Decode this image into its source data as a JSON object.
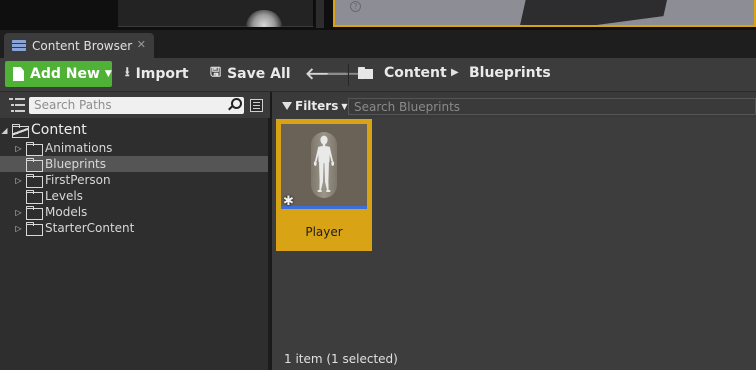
{
  "tab": {
    "title": "Content Browser",
    "close_glyph": "✕"
  },
  "toolbar": {
    "add_new": "Add New",
    "import": "Import",
    "save_all": "Save All",
    "back_glyph": "🡐",
    "forward_glyph": "🡒"
  },
  "breadcrumb": {
    "items": [
      "Content",
      "Blueprints"
    ],
    "separator": "▶"
  },
  "sources": {
    "search_placeholder": "Search Paths",
    "tree": [
      {
        "label": "Content",
        "level": 0,
        "expanded": true,
        "selected": false
      },
      {
        "label": "Animations",
        "level": 1,
        "expandable": true,
        "selected": false
      },
      {
        "label": "Blueprints",
        "level": 1,
        "expandable": false,
        "selected": true
      },
      {
        "label": "FirstPerson",
        "level": 1,
        "expandable": true,
        "selected": false
      },
      {
        "label": "Levels",
        "level": 1,
        "expandable": false,
        "selected": false
      },
      {
        "label": "Models",
        "level": 1,
        "expandable": true,
        "selected": false
      },
      {
        "label": "StarterContent",
        "level": 1,
        "expandable": true,
        "selected": false
      }
    ]
  },
  "assets": {
    "filters_label": "Filters",
    "search_placeholder": "Search Blueprints",
    "items": [
      {
        "name": "Player",
        "selected": true,
        "icon": "blueprint-character-thumbnail"
      }
    ],
    "status": "1 item (1 selected)"
  },
  "colors": {
    "accent_green": "#4fb237",
    "selection_gold": "#d9a316",
    "asset_bar_blue": "#3c6edc"
  }
}
